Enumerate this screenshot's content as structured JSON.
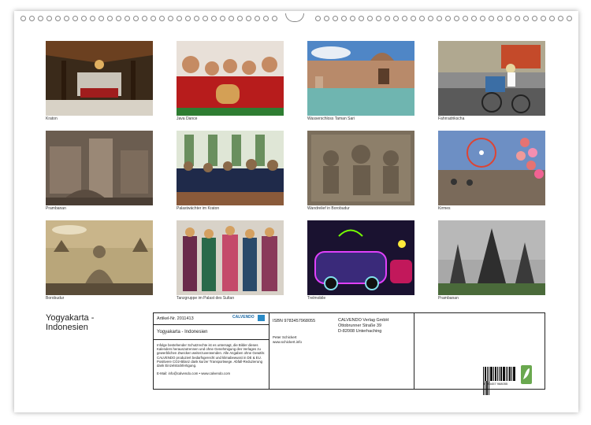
{
  "calendar": {
    "title_line1": "Yogyakarta -",
    "title_line2": "Indonesien",
    "photos": [
      {
        "caption": "Kraton",
        "icon": "pavilion"
      },
      {
        "caption": "Java Dance",
        "icon": "dancers"
      },
      {
        "caption": "Wasserschloss Taman Sari",
        "icon": "water-castle"
      },
      {
        "caption": "Fahrradrikscha",
        "icon": "rickshaw"
      },
      {
        "caption": "Prambanan",
        "icon": "temple-ruins"
      },
      {
        "caption": "Palastwächter im Kraton",
        "icon": "palace-guards"
      },
      {
        "caption": "Wandrelief in Borobudur",
        "icon": "relief"
      },
      {
        "caption": "Kirmes",
        "icon": "fair"
      },
      {
        "caption": "Borobudur",
        "icon": "buddha"
      },
      {
        "caption": "Tanzgruppe im Palast des Sultan",
        "icon": "dance-group"
      },
      {
        "caption": "Trelmobile",
        "icon": "light-cars"
      },
      {
        "caption": "Prambanan",
        "icon": "prambanan-temple"
      }
    ],
    "info": {
      "article": "Artikel-Nr. 2011413",
      "brand": "CALVENDO",
      "product_title": "Yogyakarta - Indonesien",
      "isbn": "ISBN 9783457968055",
      "author": "Peter Schickert",
      "author_web": "www.schickert.info",
      "publisher_name": "CALVENDO Verlag GmbH",
      "publisher_street": "Ottobrunner Straße 39",
      "publisher_city": "D-82008 Unterhaching",
      "legal_text": "Infolge bestehender Schutzrechte ist es untersagt, die Bilder dieses Kalenders herauszutrennen und ohne Genehmigung des Verlages zu gewerblichen Zwecken weiterzuverwenden. Alle Angaben ohne Gewähr. CALVENDO produziert bedarfsgerecht und klimabewusst in DE & EU. Positivere CO2-Bilanz dank kurzer Transportwege. Abfall-Reduzierung dank Einzelstückfertigung.",
      "email": "E-Mail: info@calvendo.com • www.calvendo.com",
      "barcode_number": "9 783457 968055"
    }
  }
}
